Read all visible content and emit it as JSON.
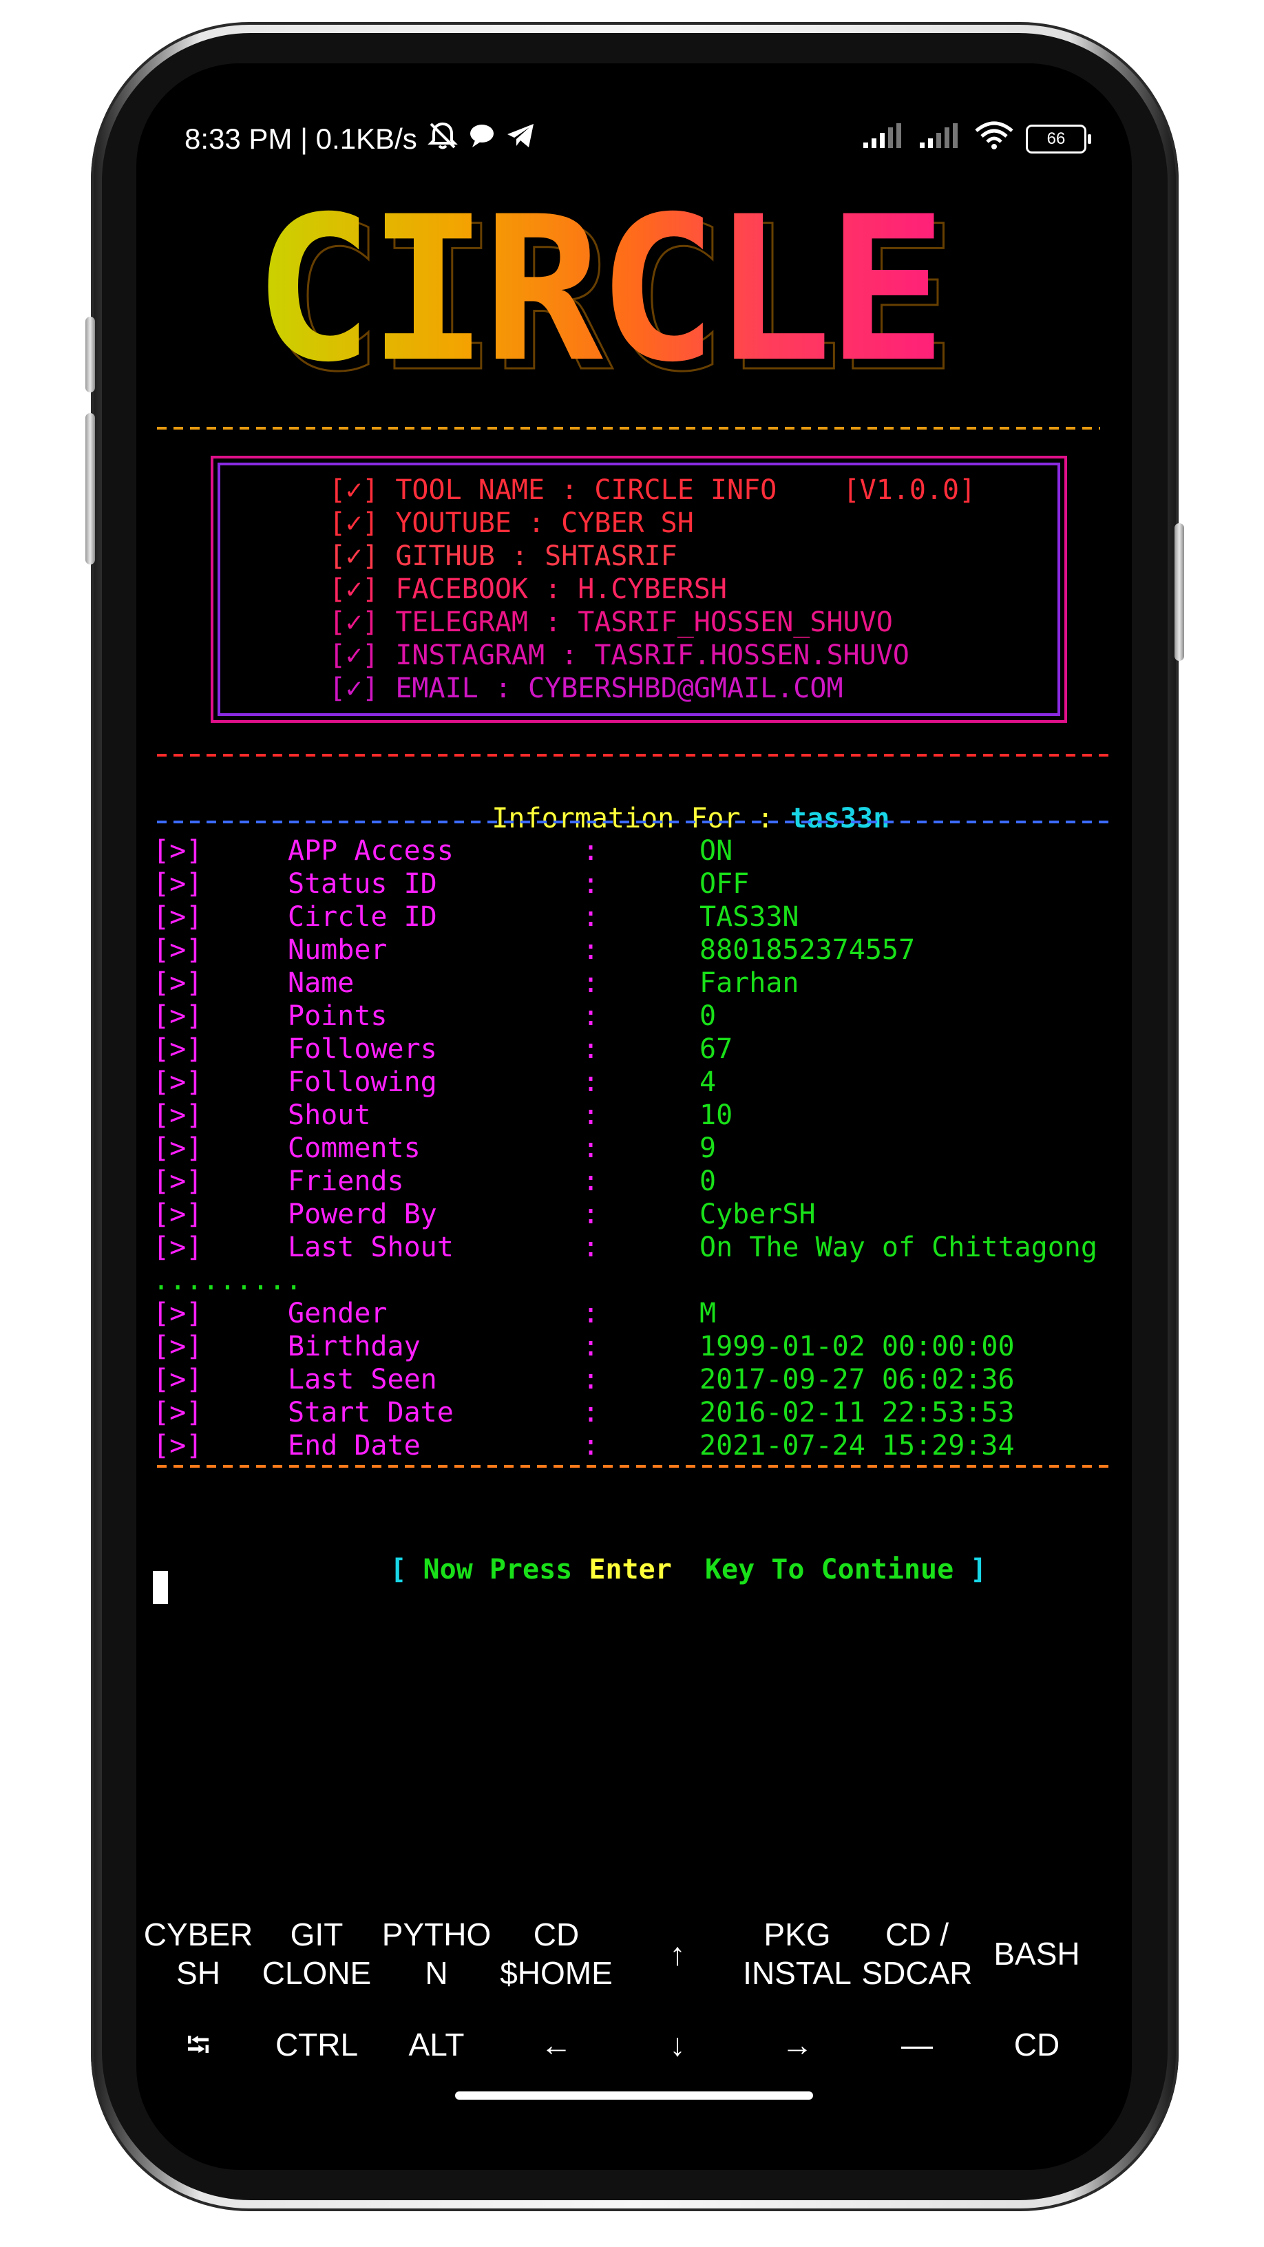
{
  "status_bar": {
    "time": "8:33 PM | 0.1KB/s",
    "battery": "66",
    "icons": [
      "mute-bell-icon",
      "chat-bubble-icon",
      "telegram-icon",
      "signal-icon",
      "signal-icon-2",
      "wifi-icon",
      "battery-icon"
    ]
  },
  "banner": {
    "text": "CIRCLE"
  },
  "tool_info": {
    "lines": [
      "[✓] TOOL NAME : CIRCLE INFO    [V1.0.0]",
      "[✓] YOUTUBE : CYBER SH",
      "[✓] GITHUB : SHTASRIF",
      "[✓] FACEBOOK : H.CYBERSH",
      "[✓] TELEGRAM : TASRIF_HOSSEN_SHUVO",
      "[✓] INSTAGRAM : TASRIF.HOSSEN.SHUVO",
      "[✓] EMAIL : CYBERSHBD@GMAIL.COM"
    ]
  },
  "info_for": {
    "label": "Information For",
    "sep": ":",
    "user": "tas33n"
  },
  "rows": [
    {
      "label": "APP Access",
      "value": "ON"
    },
    {
      "label": "Status ID",
      "value": "OFF"
    },
    {
      "label": "Circle ID",
      "value": "TAS33N"
    },
    {
      "label": "Number",
      "value": "8801852374557"
    },
    {
      "label": "Name",
      "value": "Farhan"
    },
    {
      "label": "Points",
      "value": "0"
    },
    {
      "label": "Followers",
      "value": "67"
    },
    {
      "label": "Following",
      "value": "4"
    },
    {
      "label": "Shout",
      "value": "10"
    },
    {
      "label": "Comments",
      "value": "9"
    },
    {
      "label": "Friends",
      "value": "0"
    },
    {
      "label": "Powerd By",
      "value": "CyberSH"
    },
    {
      "label": "Last Shout",
      "value": "On The Way of Chittagong"
    }
  ],
  "dots": ".........",
  "rows2": [
    {
      "label": "Gender",
      "value": "M"
    },
    {
      "label": "Birthday",
      "value": "1999-01-02 00:00:00"
    },
    {
      "label": "Last Seen",
      "value": "2017-09-27 06:02:36"
    },
    {
      "label": "Start Date",
      "value": "2016-02-11 22:53:53"
    },
    {
      "label": "End Date",
      "value": "2021-07-24 15:29:34"
    }
  ],
  "row_prefix": "[>]",
  "row_sep": ":",
  "prompt": {
    "open": "[",
    "part1": "Now Press",
    "enter": "Enter",
    "part2": "Key To Continue",
    "close": "]"
  },
  "extra_keys": {
    "row1": [
      {
        "label": "CYBER\nSH"
      },
      {
        "label": "GIT\nCLONE"
      },
      {
        "label": "PYTHO\nN"
      },
      {
        "label": "CD\n$HOME"
      },
      {
        "label": "↑"
      },
      {
        "label": "PKG\nINSTAL"
      },
      {
        "label": "CD /\nSDCAR"
      },
      {
        "label": "BASH"
      }
    ],
    "row2": [
      {
        "label": "⭾"
      },
      {
        "label": "CTRL"
      },
      {
        "label": "ALT"
      },
      {
        "label": "←"
      },
      {
        "label": "↓"
      },
      {
        "label": "→"
      },
      {
        "label": "—"
      },
      {
        "label": "CD"
      }
    ]
  }
}
